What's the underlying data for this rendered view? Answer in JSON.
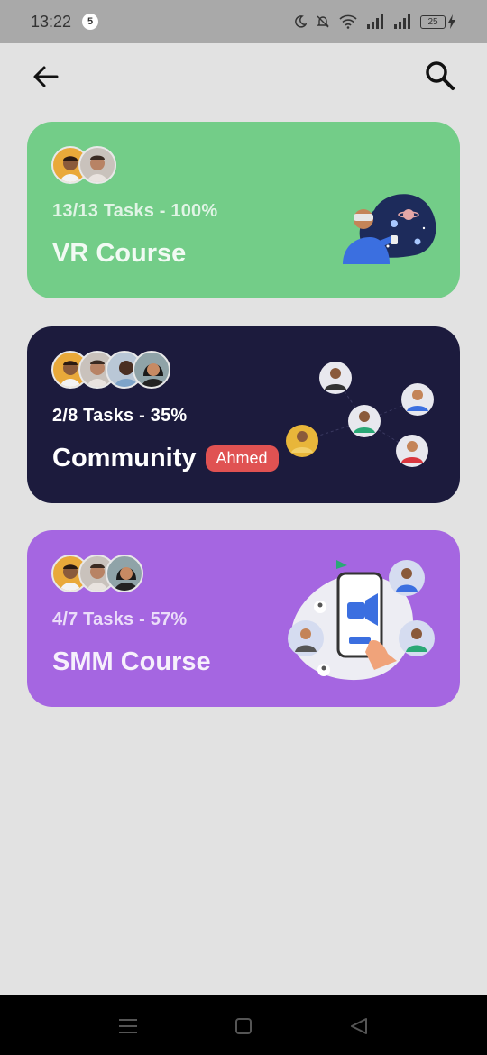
{
  "status_bar": {
    "time": "13:22",
    "notification_count": "5",
    "battery": "25"
  },
  "cards": [
    {
      "progress": "13/13 Tasks - 100%",
      "title": "VR Course",
      "color": "#73cd88"
    },
    {
      "progress": "2/8 Tasks - 35%",
      "title": "Community",
      "tag": "Ahmed",
      "color": "#1c1b3d"
    },
    {
      "progress": "4/7 Tasks - 57%",
      "title": "SMM Course",
      "color": "#a566e1"
    }
  ],
  "icons": {
    "back": "arrow-left-icon",
    "search": "search-icon"
  }
}
